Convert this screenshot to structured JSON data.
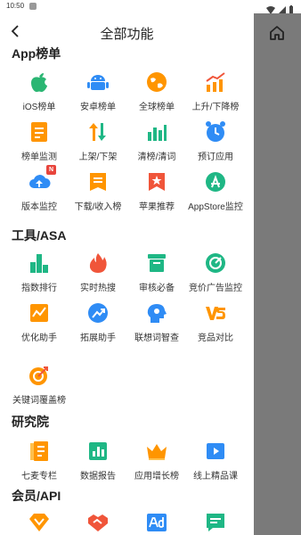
{
  "status_bar": {
    "time": "10:50"
  },
  "header": {
    "title": "全部功能"
  },
  "sections": {
    "app_rank": {
      "title": "App榜单",
      "items": [
        "iOS榜单",
        "安卓榜单",
        "全球榜单",
        "上升/下降榜",
        "榜单监测",
        "上架/下架",
        "清榜/清词",
        "预订应用",
        "版本监控",
        "下载/收入榜",
        "苹果推荐",
        "AppStore监控"
      ],
      "badge": "N"
    },
    "tools": {
      "title": "工具/ASA",
      "items": [
        "指数排行",
        "实时热搜",
        "审核必备",
        "竞价广告监控",
        "优化助手",
        "拓展助手",
        "联想词智查",
        "竞品对比",
        "关键词覆盖榜"
      ]
    },
    "research": {
      "title": "研究院",
      "items": [
        "七麦专栏",
        "数据报告",
        "应用增长榜",
        "线上精品课"
      ]
    },
    "member": {
      "title": "会员/API",
      "items": [
        "",
        "",
        "",
        ""
      ]
    }
  },
  "icons": {
    "app_rank": [
      "apple-icon",
      "android-icon",
      "globe-icon",
      "trend-chart-icon",
      "monitor-doc-icon",
      "up-down-arrows-icon",
      "bar-chart-icon",
      "alarm-clock-icon",
      "cloud-upload-icon",
      "download-doc-icon",
      "bookmark-star-icon",
      "appstore-icon"
    ],
    "tools": [
      "bar-rank-icon",
      "flame-icon",
      "review-box-icon",
      "target-icon",
      "optimize-chart-icon",
      "expand-arrow-icon",
      "brain-search-icon",
      "vs-icon",
      "keyword-target-icon"
    ],
    "research": [
      "column-doc-icon",
      "report-chart-icon",
      "crown-icon",
      "video-play-icon"
    ],
    "member": [
      "vip-badge-icon",
      "handshake-icon",
      "ad-icon",
      "api-doc-icon"
    ]
  },
  "colors": {
    "orange": "#FF9500",
    "blue": "#2F8CF5",
    "green": "#1FB785",
    "red": "#F0553A",
    "sidebar": "#7A7A7A"
  }
}
